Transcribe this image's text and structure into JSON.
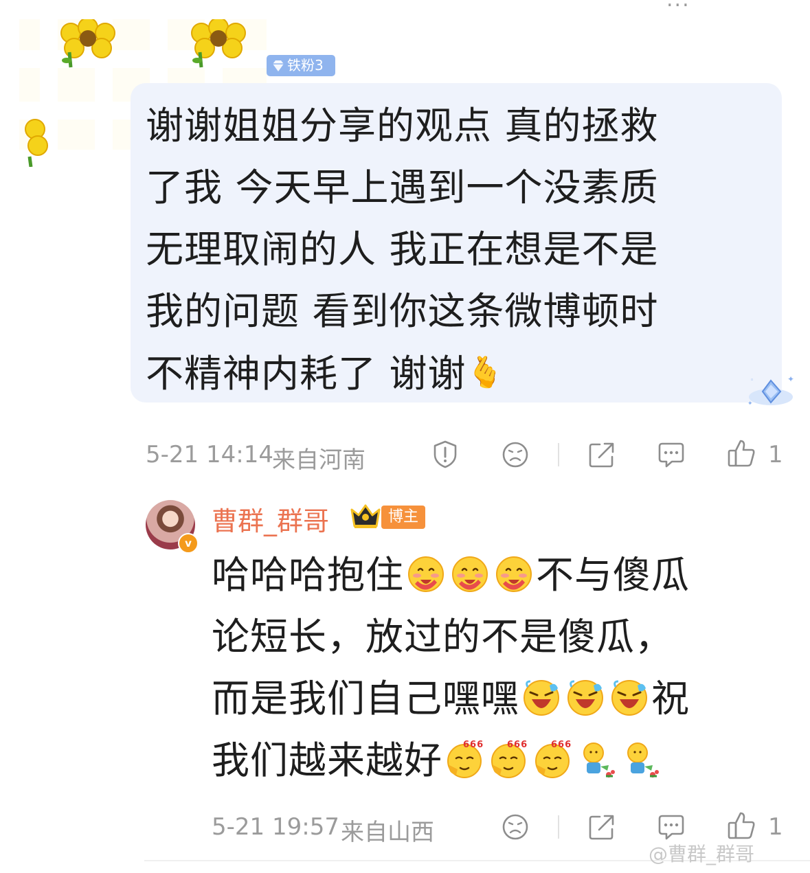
{
  "top_cutoff": "...",
  "comment1": {
    "fan_badge": "铁粉3",
    "lines": [
      "谢谢姐姐分享的观点 真的拯救",
      "了我 今天早上遇到一个没素质",
      "无理取闹的人 我正在想是不是",
      "我的问题 看到你这条微博顿时",
      "不精神内耗了 谢谢"
    ],
    "end_emoji": "🫰",
    "time": "5-21 14:14",
    "location": "来自河南",
    "like_count": "1"
  },
  "reply": {
    "username": "曹群_群哥",
    "verified_badge": "v",
    "host_badge": "博主",
    "line1_start": "哈哈哈抱住",
    "line1_end": "不与傻瓜",
    "line2": "论短长，放过的不是傻瓜，",
    "line3_start": "而是我们自己嘿嘿",
    "line3_end": "祝",
    "line4_start": "我们越来越好",
    "emoji_hug": "hug-emoji",
    "emoji_laugh": "laugh-cry-emoji",
    "emoji_666": "666-emoji",
    "emoji_water": "watering-emoji",
    "time": "5-21 19:57",
    "location": "来自山西",
    "like_count": "1"
  },
  "watermark": "@曹群_群哥",
  "colors": {
    "username": "#eb7350",
    "bubble_bg": "#eff3fc",
    "fan_badge_bg": "#8fb4ee",
    "host_badge_bg": "#f6913b",
    "meta_text": "#9b9b9b"
  }
}
